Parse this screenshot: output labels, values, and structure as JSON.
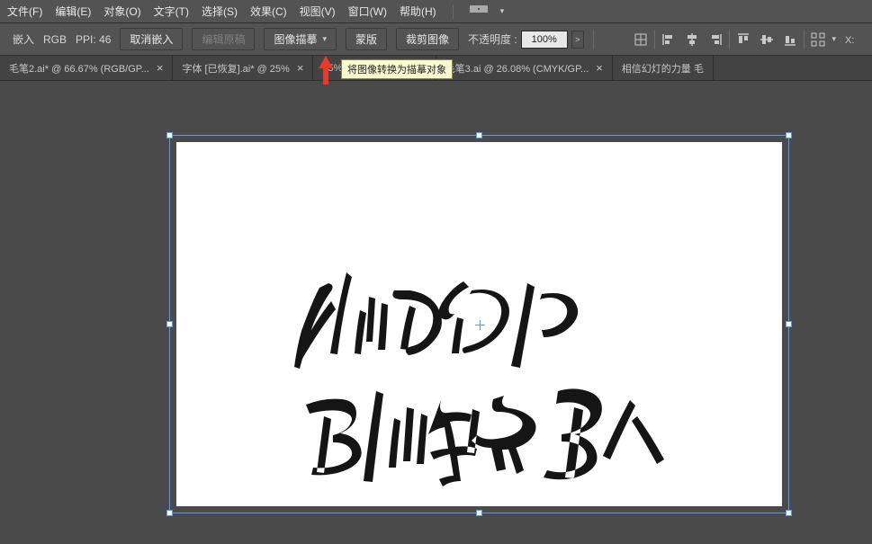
{
  "menu": {
    "file": "文件(F)",
    "edit": "编辑(E)",
    "object": "对象(O)",
    "text": "文字(T)",
    "select": "选择(S)",
    "effect": "效果(C)",
    "view": "视图(V)",
    "window": "窗口(W)",
    "help": "帮助(H)"
  },
  "ctrl": {
    "embed": "嵌入",
    "colormode": "RGB",
    "ppi_label": "PPI:",
    "ppi_value": "46",
    "unembed": "取消嵌入",
    "edit_original": "编辑原稿",
    "image_trace": "图像描摹",
    "mask": "蒙版",
    "crop": "裁剪图像",
    "opacity_label": "不透明度 :",
    "opacity_value": "100%"
  },
  "tooltip": "将图像转换为描摹对象",
  "tabs": [
    {
      "label": "毛笔2.ai* @ 66.67% (RGB/GP..."
    },
    {
      "label": "字体 [已恢复].ai* @ 25%"
    },
    {
      "label": "25% (CMYK/GPU ..."
    },
    {
      "label": "毛笔3.ai @ 26.08% (CMYK/GP..."
    },
    {
      "label": "相信幻灯的力量 毛"
    }
  ],
  "artwork": {
    "line1": "怀m的人",
    "line2": "别听慢歌"
  }
}
